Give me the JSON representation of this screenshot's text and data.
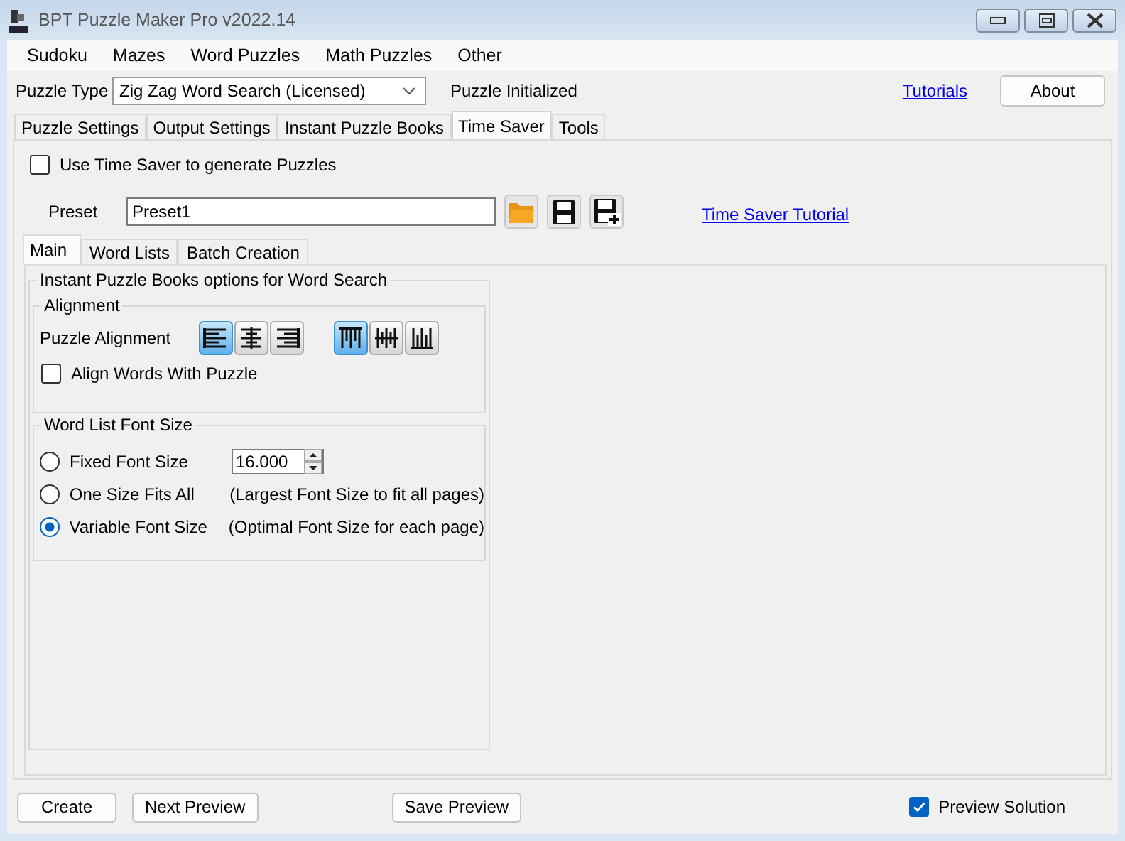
{
  "window": {
    "title": "BPT Puzzle Maker Pro v2022.14"
  },
  "menu": [
    "Sudoku",
    "Mazes",
    "Word Puzzles",
    "Math Puzzles",
    "Other"
  ],
  "puzzle_type": {
    "label": "Puzzle Type",
    "value": "Zig Zag Word Search (Licensed)"
  },
  "status": "Puzzle Initialized",
  "tutorials_link": "Tutorials",
  "about_button": "About",
  "tabs": [
    {
      "label": "Puzzle Settings",
      "selected": false
    },
    {
      "label": "Output Settings",
      "selected": false
    },
    {
      "label": "Instant Puzzle Books",
      "selected": false
    },
    {
      "label": "Time Saver",
      "selected": true
    },
    {
      "label": "Tools",
      "selected": false
    }
  ],
  "use_time_saver": {
    "label": "Use Time Saver to generate Puzzles",
    "checked": false
  },
  "preset": {
    "label": "Preset",
    "value": "Preset1"
  },
  "time_saver_tutorial_link": "Time Saver Tutorial",
  "inner_tabs": [
    {
      "label": "Main",
      "selected": true
    },
    {
      "label": "Word Lists",
      "selected": false
    },
    {
      "label": "Batch Creation",
      "selected": false
    }
  ],
  "options_group": {
    "title": "Instant Puzzle Books options for Word Search",
    "alignment": {
      "title": "Alignment",
      "label": "Puzzle Alignment",
      "horizontal": [
        {
          "kind": "left",
          "selected": true
        },
        {
          "kind": "center",
          "selected": false
        },
        {
          "kind": "right",
          "selected": false
        }
      ],
      "vertical": [
        {
          "kind": "top",
          "selected": true
        },
        {
          "kind": "middle",
          "selected": false
        },
        {
          "kind": "bottom",
          "selected": false
        }
      ],
      "align_words": {
        "label": "Align Words With Puzzle",
        "checked": false
      }
    },
    "font_size": {
      "title": "Word List Font Size",
      "options": [
        {
          "kind": "spinner",
          "label": "Fixed Font Size",
          "selected": false,
          "value": "16.000"
        },
        {
          "kind": "note",
          "label": "One Size Fits All",
          "selected": false,
          "note": "(Largest Font Size to fit all pages)"
        },
        {
          "kind": "note",
          "label": "Variable Font Size",
          "selected": true,
          "note": "(Optimal Font Size for each page)"
        }
      ]
    }
  },
  "bottom_buttons": [
    "Create",
    "Next Preview",
    "Save Preview"
  ],
  "preview_solution": {
    "label": "Preview Solution",
    "checked": true
  }
}
